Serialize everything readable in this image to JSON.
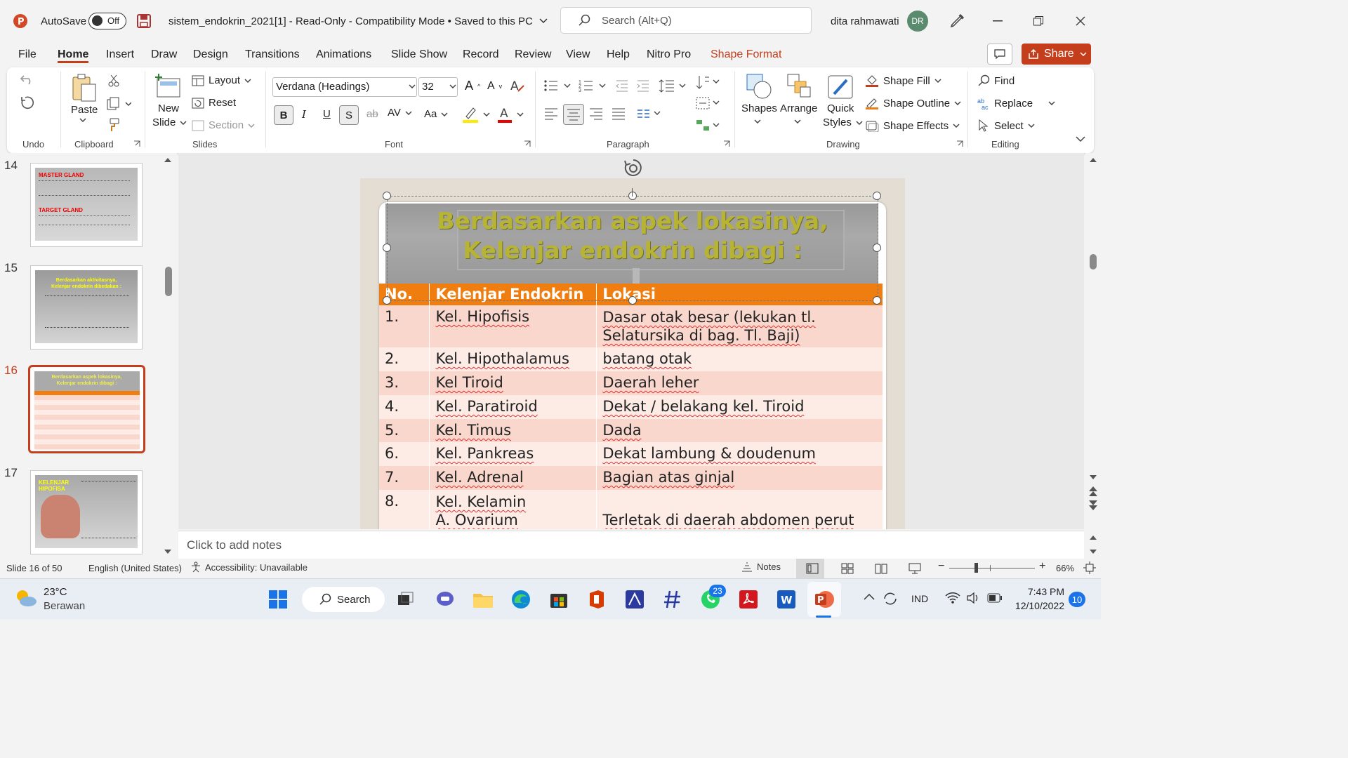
{
  "titlebar": {
    "autosave_label": "AutoSave",
    "autosave_state": "Off",
    "doc_title": "sistem_endokrin_2021[1]  -  Read-Only  -  Compatibility Mode • Saved to this PC",
    "search_placeholder": "Search (Alt+Q)",
    "user_name": "dita rahmawati",
    "user_initials": "DR"
  },
  "menu": {
    "tabs": [
      "File",
      "Home",
      "Insert",
      "Draw",
      "Design",
      "Transitions",
      "Animations",
      "Slide Show",
      "Record",
      "Review",
      "View",
      "Help",
      "Nitro Pro",
      "Shape Format"
    ],
    "share_label": "Share"
  },
  "ribbon": {
    "undo_group": "Undo",
    "clipboard": {
      "paste": "Paste",
      "group": "Clipboard"
    },
    "slides": {
      "new_slide_1": "New",
      "new_slide_2": "Slide",
      "layout": "Layout",
      "reset": "Reset",
      "section": "Section",
      "group": "Slides"
    },
    "font": {
      "family": "Verdana (Headings)",
      "size": "32",
      "group": "Font"
    },
    "paragraph": {
      "group": "Paragraph"
    },
    "drawing": {
      "shapes": "Shapes",
      "arrange": "Arrange",
      "quick_styles_1": "Quick",
      "quick_styles_2": "Styles",
      "shape_fill": "Shape Fill",
      "shape_outline": "Shape Outline",
      "shape_effects": "Shape Effects",
      "group": "Drawing"
    },
    "editing": {
      "find": "Find",
      "replace": "Replace",
      "select": "Select",
      "group": "Editing"
    }
  },
  "thumbnails": {
    "slides": [
      {
        "number": "14",
        "line1": "MASTER GLAND",
        "line2": "TARGET GLAND"
      },
      {
        "number": "15",
        "line1": "Berdasarkan aktivitasnya,",
        "line2": "Kelenjar endokrin dibedakan :"
      },
      {
        "number": "16",
        "line1": "Berdasarkan aspek lokasinya,",
        "line2": "Kelenjar endokrin dibagi :"
      },
      {
        "number": "17",
        "line1": "KELENJAR",
        "line2": "HIPOFISA"
      }
    ]
  },
  "slide": {
    "title_line1": "Berdasarkan aspek lokasinya,",
    "title_line2": "Kelenjar endokrin dibagi :",
    "headers": [
      "No.",
      "Kelenjar Endokrin",
      "Lokasi"
    ],
    "rows": [
      {
        "no": "1.",
        "gland": "Kel. Hipofisis",
        "gland2": "",
        "loc": "Dasar otak besar (lekukan tl.",
        "loc2": "Selatursika di bag. Tl. Baji)"
      },
      {
        "no": "2.",
        "gland": "Kel. Hipothalamus",
        "gland2": "",
        "loc": "batang otak",
        "loc2": ""
      },
      {
        "no": "3.",
        "gland": "Kel Tiroid",
        "gland2": "",
        "loc": "Daerah leher",
        "loc2": ""
      },
      {
        "no": "4.",
        "gland": "Kel. Paratiroid",
        "gland2": "",
        "loc": "Dekat / belakang kel. Tiroid",
        "loc2": ""
      },
      {
        "no": "5.",
        "gland": "Kel. Timus",
        "gland2": "",
        "loc": "Dada",
        "loc2": ""
      },
      {
        "no": "6.",
        "gland": "Kel. Pankreas",
        "gland2": "",
        "loc": "Dekat lambung & doudenum",
        "loc2": ""
      },
      {
        "no": "7.",
        "gland": "Kel. Adrenal",
        "gland2": "",
        "loc": "Bagian atas ginjal",
        "loc2": ""
      },
      {
        "no": "8.",
        "gland": "Kel. Kelamin",
        "gland2": "A. Ovarium",
        "loc": "",
        "loc2": "Terletak di daerah abdomen perut"
      }
    ]
  },
  "notes_placeholder": "Click to add notes",
  "status": {
    "slide_info": "Slide 16 of 50",
    "language": "English (United States)",
    "accessibility": "Accessibility: Unavailable",
    "notes": "Notes",
    "zoom": "66%"
  },
  "taskbar": {
    "weather_temp": "23°C",
    "weather_desc": "Berawan",
    "search": "Search",
    "whatsapp_badge": "23",
    "lang": "IND",
    "time": "7:43 PM",
    "date": "12/10/2022",
    "notif_count": "10"
  },
  "colors": {
    "accent": "#c43e1c",
    "table_header": "#ef7d10",
    "title_text": "#b7b335"
  }
}
